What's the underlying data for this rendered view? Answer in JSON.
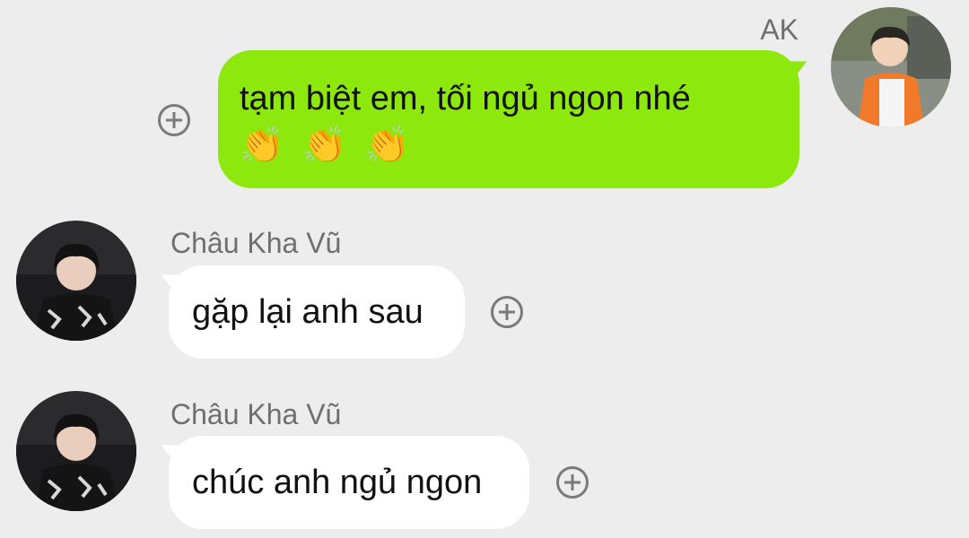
{
  "messages": [
    {
      "sender": "AK",
      "direction": "outgoing",
      "text": "tạm biệt em, tối ngủ ngon nhé",
      "emojis": [
        "👏",
        "👏",
        "👏"
      ],
      "avatar_icon": "user-avatar-orange-jacket-icon",
      "action_icon": "add-reaction-icon"
    },
    {
      "sender": "Châu Kha Vũ",
      "direction": "incoming",
      "text": "gặp lại anh sau",
      "avatar_icon": "user-avatar-dark-shirt-icon",
      "action_icon": "add-reaction-icon"
    },
    {
      "sender": "Châu Kha Vũ",
      "direction": "incoming",
      "text": "chúc anh ngủ ngon",
      "avatar_icon": "user-avatar-dark-shirt-icon",
      "action_icon": "add-reaction-icon"
    }
  ],
  "colors": {
    "background": "#ededed",
    "outgoing_bubble": "#8de80d",
    "incoming_bubble": "#ffffff",
    "name_text": "#6f6f6f",
    "icon": "#7a7a7a"
  }
}
